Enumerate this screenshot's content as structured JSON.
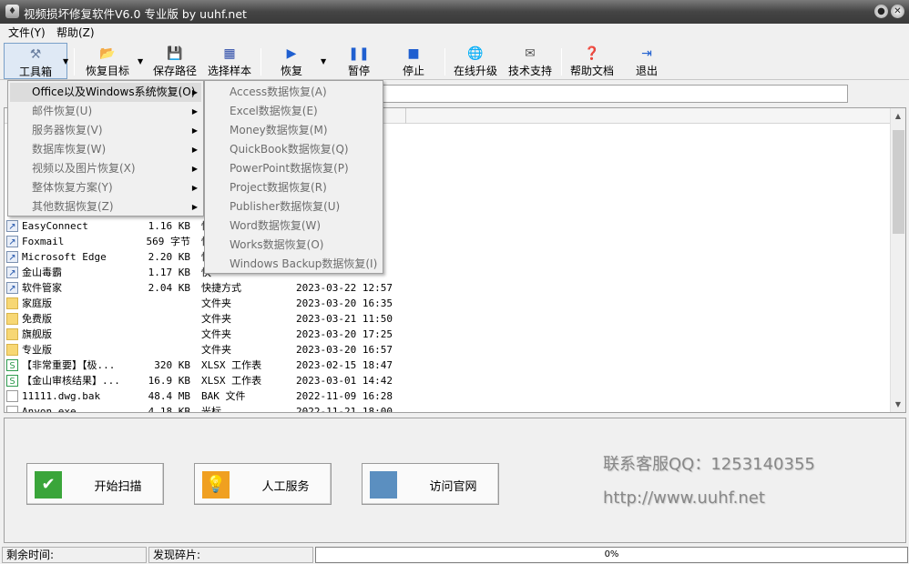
{
  "window": {
    "title": "视频损坏修复软件V6.0 专业版 by uuhf.net",
    "min": "●",
    "close": "✕"
  },
  "menubar": [
    "文件(Y)",
    "帮助(Z)"
  ],
  "toolbar": {
    "tools": "工具箱",
    "recover_target": "恢复目标",
    "save_path": "保存路径",
    "select_sample": "选择样本",
    "recover": "恢复",
    "pause": "暂停",
    "stop": "停止",
    "online_upgrade": "在线升级",
    "tech_support": "技术支持",
    "help_doc": "帮助文档",
    "exit": "退出"
  },
  "tool_menu": [
    {
      "label": "Office以及Windows系统恢复(O)",
      "highlighted": true
    },
    {
      "label": "邮件恢复(U)"
    },
    {
      "label": "服务器恢复(V)"
    },
    {
      "label": "数据库恢复(W)"
    },
    {
      "label": "视频以及图片恢复(X)"
    },
    {
      "label": "整体恢复方案(Y)"
    },
    {
      "label": "其他数据恢复(Z)"
    }
  ],
  "office_submenu": [
    "Access数据恢复(A)",
    "Excel数据恢复(E)",
    "Money数据恢复(M)",
    "QuickBook数据恢复(Q)",
    "PowerPoint数据恢复(P)",
    "Project数据恢复(R)",
    "Publisher数据恢复(U)",
    "Word数据恢复(W)",
    "Works数据恢复(O)",
    "Windows Backup数据恢复(I)"
  ],
  "files": [
    {
      "name": "EasyConnect",
      "size": "1.16 KB",
      "type": "快",
      "date": "",
      "icon": "exe"
    },
    {
      "name": "Foxmail",
      "size": "569 字节",
      "type": "快",
      "date": "",
      "icon": "exe"
    },
    {
      "name": "Microsoft Edge",
      "size": "2.20 KB",
      "type": "快",
      "date": "",
      "icon": "exe"
    },
    {
      "name": "金山毒霸",
      "size": "1.17 KB",
      "type": "快",
      "date": "",
      "icon": "exe"
    },
    {
      "name": "软件管家",
      "size": "2.04 KB",
      "type": "快捷方式",
      "date": "2023-03-22 12:57",
      "icon": "exe"
    },
    {
      "name": "家庭版",
      "size": "",
      "type": "文件夹",
      "date": "2023-03-20 16:35",
      "icon": "folder"
    },
    {
      "name": "免费版",
      "size": "",
      "type": "文件夹",
      "date": "2023-03-21 11:50",
      "icon": "folder"
    },
    {
      "name": "旗舰版",
      "size": "",
      "type": "文件夹",
      "date": "2023-03-20 17:25",
      "icon": "folder"
    },
    {
      "name": "专业版",
      "size": "",
      "type": "文件夹",
      "date": "2023-03-20 16:57",
      "icon": "folder"
    },
    {
      "name": "【非常重要】【极...",
      "size": "320 KB",
      "type": "XLSX 工作表",
      "date": "2023-02-15 18:47",
      "icon": "xlsx"
    },
    {
      "name": "【金山审核结果】...",
      "size": "16.9 KB",
      "type": "XLSX 工作表",
      "date": "2023-03-01 14:42",
      "icon": "xlsx"
    },
    {
      "name": "11111.dwg.bak",
      "size": "48.4 MB",
      "type": "BAK 文件",
      "date": "2022-11-09 16:28",
      "icon": "file"
    },
    {
      "name": "Anyon.exe",
      "size": "4.18 KB",
      "type": "光标",
      "date": "2022-11-21 18:00",
      "icon": "file"
    }
  ],
  "buttons": {
    "start_scan": "开始扫描",
    "manual_service": "人工服务",
    "visit_site": "访问官网"
  },
  "contact": {
    "qq": "联系客服QQ：1253140355",
    "url": "http://www.uuhf.net"
  },
  "status": {
    "remaining": "剩余时间:",
    "fragments": "发现碎片:",
    "progress": "0%"
  }
}
